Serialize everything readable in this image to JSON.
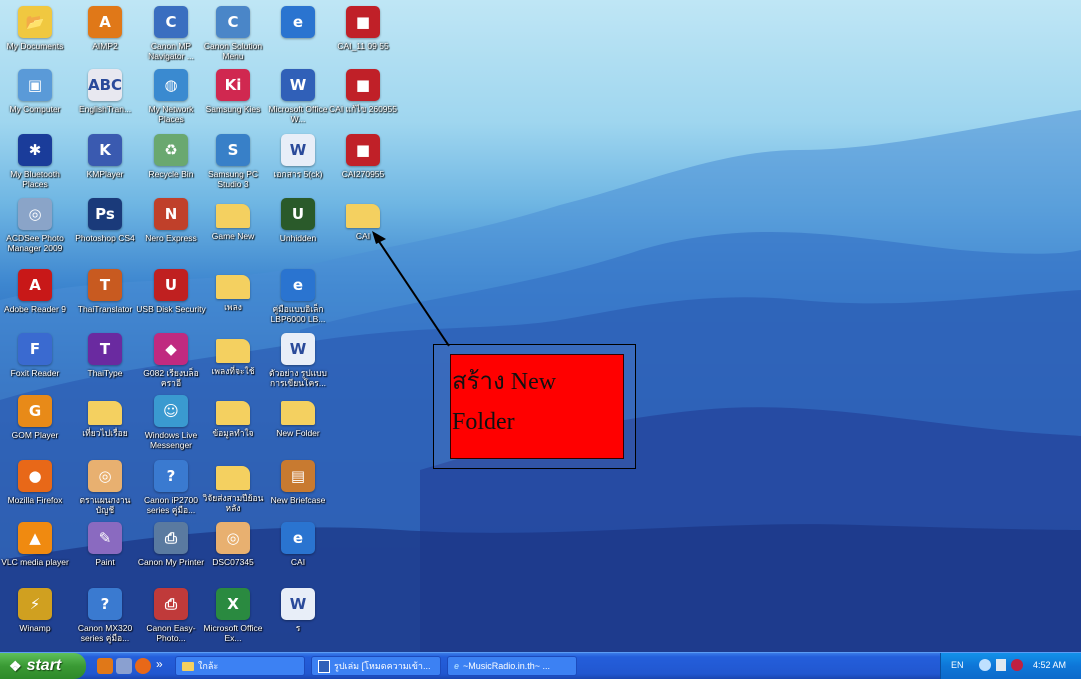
{
  "desktop": {
    "icons": [
      {
        "label": "My Documents",
        "icon": "folder-documents-icon",
        "color": "#f0c840",
        "sym": "📂"
      },
      {
        "label": "AIMP2",
        "icon": "aimp-icon",
        "color": "#e07818",
        "sym": "A"
      },
      {
        "label": "Canon MP Navigator ...",
        "icon": "canon-navigator-icon",
        "color": "#3a6ec0",
        "sym": "C"
      },
      {
        "label": "Canon Solution Menu",
        "icon": "canon-menu-icon",
        "color": "#4a86c8",
        "sym": "C"
      },
      {
        "label": "",
        "icon": "internet-explorer-icon",
        "color": "#2a74d0",
        "sym": "e"
      },
      {
        "label": "CAI_11 09 55",
        "icon": "winrar-archive-icon",
        "color": "#c02028",
        "sym": "■"
      },
      {
        "label": "My Computer",
        "icon": "my-computer-icon",
        "color": "#5a9ad8",
        "sym": "▣"
      },
      {
        "label": "EnglishTran...",
        "icon": "english-translator-icon",
        "color": "#e8e8f0",
        "sym": "ABC"
      },
      {
        "label": "My Network Places",
        "icon": "network-places-icon",
        "color": "#3a8ad0",
        "sym": "◍"
      },
      {
        "label": "Samsung Kies",
        "icon": "samsung-kies-icon",
        "color": "#d02850",
        "sym": "Ki"
      },
      {
        "label": "Microsoft Office W...",
        "icon": "word-icon",
        "color": "#3060b8",
        "sym": "W"
      },
      {
        "label": "CAI แก้ไข 260955",
        "icon": "winrar-archive-icon",
        "color": "#c02028",
        "sym": "■"
      },
      {
        "label": "My Bluetooth Places",
        "icon": "bluetooth-icon",
        "color": "#1a3c9a",
        "sym": "✱"
      },
      {
        "label": "KMPlayer",
        "icon": "kmplayer-icon",
        "color": "#3a5ab0",
        "sym": "K"
      },
      {
        "label": "Recycle Bin",
        "icon": "recycle-bin-icon",
        "color": "#6aa870",
        "sym": "♻"
      },
      {
        "label": "Samsung PC Studio 3",
        "icon": "samsung-pc-studio-icon",
        "color": "#3880c8",
        "sym": "S"
      },
      {
        "label": "เอกสาร 5(ck)",
        "icon": "word-document-icon",
        "color": "#e8eef8",
        "sym": "W"
      },
      {
        "label": "CAI270955",
        "icon": "winrar-archive-icon",
        "color": "#c02028",
        "sym": "■"
      },
      {
        "label": "ACDSee Photo Manager 2009",
        "icon": "acdsee-icon",
        "color": "#8aa4c8",
        "sym": "◎"
      },
      {
        "label": "Photoshop CS4",
        "icon": "photoshop-icon",
        "color": "#1a3a7a",
        "sym": "Ps"
      },
      {
        "label": "Nero Express",
        "icon": "nero-icon",
        "color": "#c0402a",
        "sym": "N"
      },
      {
        "label": "Game New",
        "icon": "folder-icon",
        "color": "#f4d060",
        "sym": ""
      },
      {
        "label": "Unhidden",
        "icon": "unhidden-app-icon",
        "color": "#2a5a2a",
        "sym": "U"
      },
      {
        "label": "CAI",
        "icon": "folder-icon",
        "color": "#f4d060",
        "sym": ""
      },
      {
        "label": "Adobe Reader 9",
        "icon": "adobe-reader-icon",
        "color": "#c81818",
        "sym": "A"
      },
      {
        "label": "ThaiTranslator",
        "icon": "thai-translator-icon",
        "color": "#c85a20",
        "sym": "T"
      },
      {
        "label": "USB Disk Security",
        "icon": "usb-disk-security-icon",
        "color": "#c02020",
        "sym": "U"
      },
      {
        "label": "เพลง",
        "icon": "folder-icon",
        "color": "#f4d060",
        "sym": ""
      },
      {
        "label": "คู่มือแบบอิเล็ก LBP6000 LB...",
        "icon": "internet-explorer-icon",
        "color": "#2a74d0",
        "sym": "e"
      },
      {
        "label": "Foxit Reader",
        "icon": "foxit-reader-icon",
        "color": "#3a6ad0",
        "sym": "F"
      },
      {
        "label": "ThaiType",
        "icon": "thaitype-icon",
        "color": "#6a2aa0",
        "sym": "T"
      },
      {
        "label": "G082 เรียงบล็อ คราอี",
        "icon": "g082-icon",
        "color": "#c02a80",
        "sym": "◆"
      },
      {
        "label": "เพลงที่จะใช้",
        "icon": "folder-icon",
        "color": "#f4d060",
        "sym": ""
      },
      {
        "label": "ตัวอย่าง รูปแบบ การเขียนโคร...",
        "icon": "word-document-icon",
        "color": "#e8eef8",
        "sym": "W"
      },
      {
        "label": "GOM Player",
        "icon": "gom-player-icon",
        "color": "#e88a18",
        "sym": "G"
      },
      {
        "label": "เที่ยวไปเรื่อย",
        "icon": "folder-icon",
        "color": "#f4d060",
        "sym": ""
      },
      {
        "label": "Windows Live Messenger",
        "icon": "messenger-icon",
        "color": "#3a9ad0",
        "sym": "☺"
      },
      {
        "label": "ข้อมูลทำใจ",
        "icon": "folder-icon",
        "color": "#f4d060",
        "sym": ""
      },
      {
        "label": "New Folder",
        "icon": "folder-icon",
        "color": "#f4d060",
        "sym": ""
      },
      {
        "label": "Mozilla Firefox",
        "icon": "firefox-icon",
        "color": "#e86818",
        "sym": "●"
      },
      {
        "label": "ตราแผนกงาน บัญชี",
        "icon": "jpg-image-icon",
        "color": "#e8b070",
        "sym": "◎"
      },
      {
        "label": "Canon iP2700 series คู่มือ...",
        "icon": "canon-help-icon",
        "color": "#3a7ad0",
        "sym": "?"
      },
      {
        "label": "วิจัยส่งสามปีย้อนหลัง",
        "icon": "folder-icon",
        "color": "#f4d060",
        "sym": ""
      },
      {
        "label": "New Briefcase",
        "icon": "briefcase-icon",
        "color": "#c87a30",
        "sym": "▤"
      },
      {
        "label": "VLC media player",
        "icon": "vlc-icon",
        "color": "#f08a10",
        "sym": "▲"
      },
      {
        "label": "Paint",
        "icon": "paint-icon",
        "color": "#8a6ac0",
        "sym": "✎"
      },
      {
        "label": "Canon My Printer",
        "icon": "canon-printer-icon",
        "color": "#5a7aa0",
        "sym": "⎙"
      },
      {
        "label": "DSC07345",
        "icon": "jpg-image-icon",
        "color": "#e8b070",
        "sym": "◎"
      },
      {
        "label": "CAI",
        "icon": "internet-explorer-icon",
        "color": "#2a74d0",
        "sym": "e"
      },
      {
        "label": "Winamp",
        "icon": "winamp-icon",
        "color": "#d0a020",
        "sym": "⚡"
      },
      {
        "label": "Canon MX320 series คู่มือ...",
        "icon": "canon-help-icon",
        "color": "#3a7ad0",
        "sym": "?"
      },
      {
        "label": "Canon Easy-Photo...",
        "icon": "canon-easy-photo-icon",
        "color": "#c03a3a",
        "sym": "⎙"
      },
      {
        "label": "Microsoft Office Ex...",
        "icon": "excel-icon",
        "color": "#2a8a40",
        "sym": "X"
      },
      {
        "label": "ร",
        "icon": "word-document-icon",
        "color": "#e8eef8",
        "sym": "W"
      }
    ]
  },
  "callout": {
    "line1": "สร้าง New",
    "line2": "Folder"
  },
  "taskbar": {
    "start_label": "start",
    "quick_launch_more": "»",
    "buttons": [
      {
        "label": "ใกล้ะ",
        "icon": "folder-icon"
      },
      {
        "label": "รูปเล่ม [โหมดความเข้า...",
        "icon": "word-icon"
      },
      {
        "label": "~MusicRadio.in.th~ ...",
        "icon": "internet-explorer-icon"
      }
    ],
    "tray": {
      "language": "EN",
      "time": "4:52 AM"
    }
  },
  "colors": {
    "callout_fill": "#ff0000",
    "taskbar": "#245edb",
    "start": "#3a9a34"
  }
}
